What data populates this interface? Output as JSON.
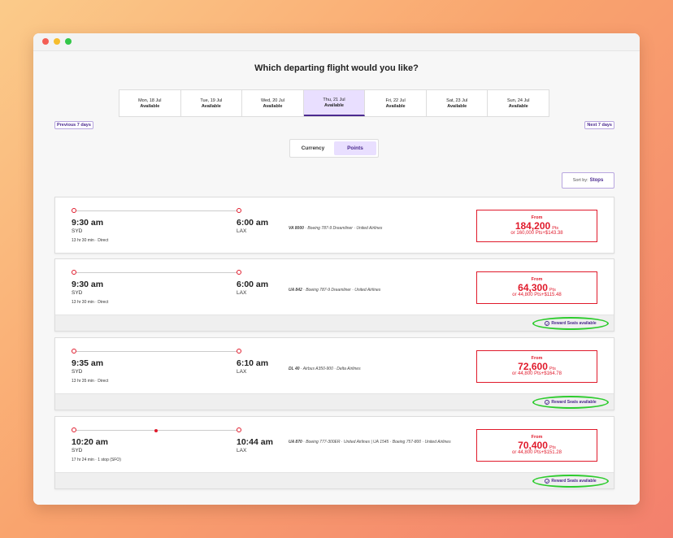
{
  "heading": "Which departing flight would you like?",
  "dates": [
    {
      "day": "Mon, 18 Jul",
      "status": "Available",
      "active": false
    },
    {
      "day": "Tue, 19 Jul",
      "status": "Available",
      "active": false
    },
    {
      "day": "Wed, 20 Jul",
      "status": "Available",
      "active": false
    },
    {
      "day": "Thu, 21 Jul",
      "status": "Available",
      "active": true
    },
    {
      "day": "Fri, 22 Jul",
      "status": "Available",
      "active": false
    },
    {
      "day": "Sat, 23 Jul",
      "status": "Available",
      "active": false
    },
    {
      "day": "Sun, 24 Jul",
      "status": "Available",
      "active": false
    }
  ],
  "pager": {
    "prev": "Previous 7 days",
    "next": "Next 7 days"
  },
  "toggle": {
    "currency": "Currency",
    "points": "Points",
    "selected": "points"
  },
  "sort": {
    "label": "Sort by:",
    "value": "Stops"
  },
  "flights": [
    {
      "dep_time": "9:30 am",
      "dep_code": "SYD",
      "arr_time": "6:00 am",
      "arr_code": "LAX",
      "duration": "13 hr 30 min · Direct",
      "flight_no": "VA 8000",
      "info": "· Boeing 787-9 Dreamliner · United Airlines",
      "from_label": "From",
      "points": "184,200",
      "pts_unit": "Pts",
      "alt_price": "or 160,000 Pts+$143.38",
      "reward": ""
    },
    {
      "dep_time": "9:30 am",
      "dep_code": "SYD",
      "arr_time": "6:00 am",
      "arr_code": "LAX",
      "duration": "13 hr 30 min · Direct",
      "flight_no": "UA 842",
      "info": "· Boeing 787-9 Dreamliner · United Airlines",
      "from_label": "From",
      "points": "64,300",
      "pts_unit": "Pts",
      "alt_price": "or 44,800 Pts+$115.48",
      "reward": "Reward Seats available"
    },
    {
      "dep_time": "9:35 am",
      "dep_code": "SYD",
      "arr_time": "6:10 am",
      "arr_code": "LAX",
      "duration": "13 hr 35 min · Direct",
      "flight_no": "DL 40",
      "info": "· Airbus A350-900 · Delta Airlines",
      "from_label": "From",
      "points": "72,600",
      "pts_unit": "Pts",
      "alt_price": "or 44,800 Pts+$164.78",
      "reward": "Reward Seats available"
    },
    {
      "dep_time": "10:20 am",
      "dep_code": "SYD",
      "arr_time": "10:44 am",
      "arr_code": "LAX",
      "duration": "17 hr 24 min · 1 stop (SFO)",
      "flight_no": "UA 870",
      "info": "· Boeing 777-300ER · United Airlines | UA 1545 · Boeing 757-800 · United Airlines",
      "from_label": "From",
      "points": "70,400",
      "pts_unit": "Pts",
      "alt_price": "or 44,800 Pts+$151.28",
      "reward": "Reward Seats available"
    }
  ],
  "colors": {
    "accent": "#4b2a8f",
    "price": "#e01a2b",
    "highlight": "#2ecc2e",
    "active_tab": "#e9dfff"
  },
  "icons": {
    "reward": "check-circle-icon"
  }
}
